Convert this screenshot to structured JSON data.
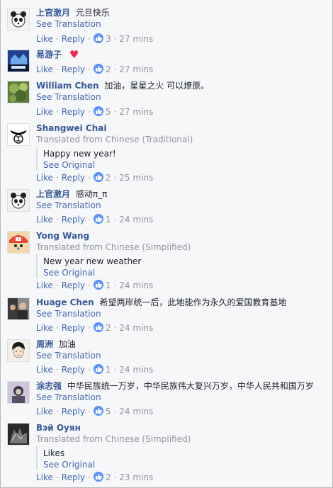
{
  "ui": {
    "like": "Like",
    "reply": "Reply",
    "dot": "·",
    "see_translation": "See Translation",
    "see_original": "See Original",
    "like_icon": "thumbs-up-icon",
    "accent_color": "#4267b2",
    "name_color": "#365899",
    "meta_color": "#90949c",
    "heart_color": "#f0284a"
  },
  "comments": [
    {
      "author": "上官激月",
      "text": "元旦快乐",
      "see_translation": "See Translation",
      "likes": "3",
      "time": "27 mins"
    },
    {
      "author": "易游子",
      "text": "",
      "heart": "♥",
      "likes": "2",
      "time": "27 mins"
    },
    {
      "author": "William Chen",
      "text": "加油，星星之火 可以燎原。",
      "see_translation": "See Translation",
      "likes": "5",
      "time": "27 mins"
    },
    {
      "author": "Shangwei Chai",
      "translated_from": "Translated from Chinese (Traditional)",
      "translation": "Happy new year!",
      "see_original": "See Original",
      "likes": "2",
      "time": "25 mins"
    },
    {
      "author": "上官激月",
      "text": "感动π_π",
      "see_translation": "See Translation",
      "likes": "1",
      "time": "24 mins"
    },
    {
      "author": "Yong Wang",
      "translated_from": "Translated from Chinese (Simplified)",
      "translation": "New year new weather",
      "see_original": "See Original",
      "likes": "1",
      "time": "24 mins"
    },
    {
      "author": "Huage Chen",
      "text": "希望两岸统一后，此地能作为永久的爱国教育基地",
      "see_translation": "See Translation",
      "likes": "2",
      "time": "24 mins"
    },
    {
      "author": "周洲",
      "text": "加油",
      "see_translation": "See Translation",
      "likes": "1",
      "time": "24 mins"
    },
    {
      "author": "涂志强",
      "text": "中华民族统一万岁，中华民族伟大复兴万岁，中华人民共和国万岁",
      "see_translation": "See Translation",
      "likes": "5",
      "time": "24 mins"
    },
    {
      "author": "Вэй Оуян",
      "translated_from": "Translated from Chinese (Simplified)",
      "translation": "Likes",
      "see_original": "See Original",
      "likes": "2",
      "time": "23 mins"
    }
  ]
}
